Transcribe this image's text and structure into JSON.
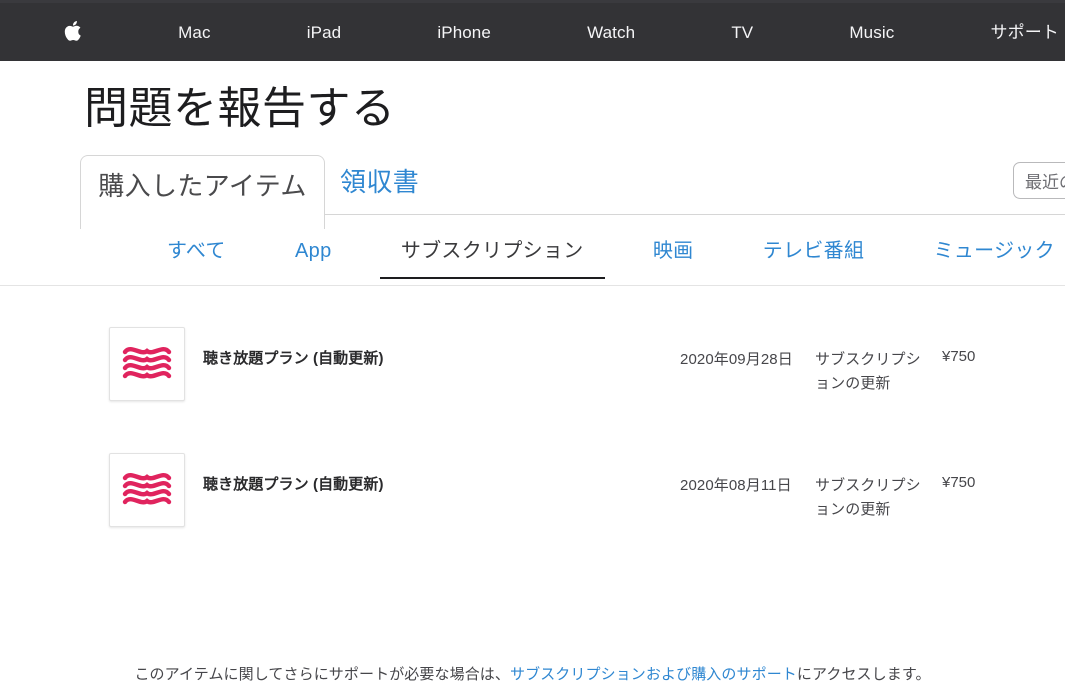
{
  "globalnav": {
    "items": [
      {
        "label": "",
        "icon": "apple-logo-icon",
        "name": "globalnav-apple"
      },
      {
        "label": "Mac",
        "name": "globalnav-mac"
      },
      {
        "label": "iPad",
        "name": "globalnav-ipad"
      },
      {
        "label": "iPhone",
        "name": "globalnav-iphone"
      },
      {
        "label": "Watch",
        "name": "globalnav-watch"
      },
      {
        "label": "TV",
        "name": "globalnav-tv"
      },
      {
        "label": "Music",
        "name": "globalnav-music"
      },
      {
        "label": "サポート",
        "name": "globalnav-support"
      }
    ]
  },
  "page": {
    "title": "問題を報告する"
  },
  "primary_tabs": {
    "active": "購入したアイテム",
    "link": "領収書"
  },
  "recent_select": {
    "value": "最近の"
  },
  "secondary_tabs": [
    {
      "label": "すべて",
      "active": false
    },
    {
      "label": "App",
      "active": false
    },
    {
      "label": "サブスクリプション",
      "active": true
    },
    {
      "label": "映画",
      "active": false
    },
    {
      "label": "テレビ番組",
      "active": false
    },
    {
      "label": "ミュージック",
      "active": false
    }
  ],
  "items": [
    {
      "icon": "audiobook-waves-icon",
      "title": "聴き放題プラン (自動更新)",
      "date": "2020年09月28日",
      "description": "サブスクリプションの更新",
      "price": "¥750"
    },
    {
      "icon": "audiobook-waves-icon",
      "title": "聴き放題プラン (自動更新)",
      "date": "2020年08月11日",
      "description": "サブスクリプションの更新",
      "price": "¥750"
    }
  ],
  "footer": {
    "prefix": "このアイテムに関してさらにサポートが必要な場合は、",
    "link": "サブスクリプションおよび購入のサポート",
    "suffix": "にアクセスします。"
  },
  "colors": {
    "nav_background": "#333336",
    "link_blue": "#2f87d1",
    "icon_red": "#e0245e",
    "text_dark": "#1d1d1f"
  }
}
